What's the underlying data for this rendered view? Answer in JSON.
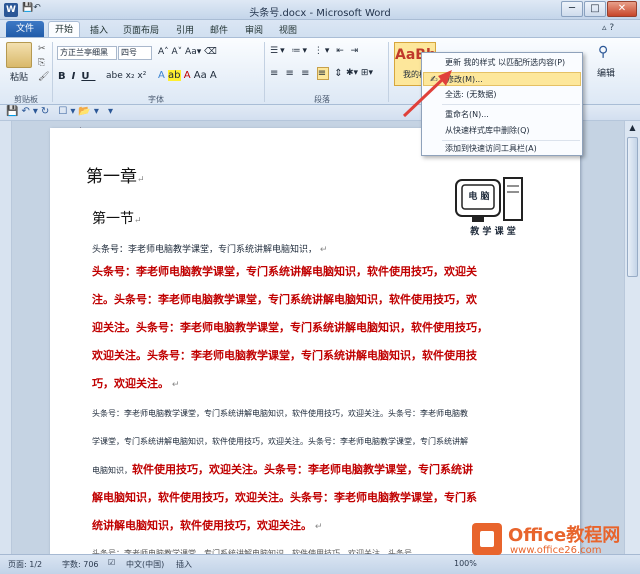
{
  "window": {
    "title": "头条号.docx - Microsoft Word",
    "app_icon": "W",
    "min": "─",
    "max": "□",
    "close": "✕"
  },
  "tabs": [
    "文件",
    "开始",
    "插入",
    "页面布局",
    "引用",
    "邮件",
    "审阅",
    "视图"
  ],
  "ribbon": {
    "paste": "粘贴",
    "clipboard_label": "剪贴板",
    "font_name": "方正兰亭细黑",
    "font_size": "四号",
    "font_label": "字体",
    "paragraph_label": "段落",
    "style_sample": "AaBb",
    "style_name": "我的样",
    "edit": "编辑"
  },
  "context_menu": {
    "items": [
      "更新 我的样式 以匹配所选内容(P)",
      "修改(M)...",
      "全选: (无数据)",
      "重命名(N)...",
      "从快速样式库中删除(Q)",
      "添加到快速访问工具栏(A)"
    ]
  },
  "document": {
    "chapter": "第一章",
    "section": "第一节",
    "logo_top": "电 脑",
    "logo_bottom": "教 学 课 堂",
    "p1": "头条号：李老师电脑教学课堂，专门系统讲解电脑知识，",
    "p2_lines": [
      "头条号：李老师电脑教学课堂，专门系统讲解电脑知识，软件使用技巧，欢迎关",
      "注。头条号：李老师电脑教学课堂，专门系统讲解电脑知识，软件使用技巧，欢",
      "迎关注。头条号：李老师电脑教学课堂，专门系统讲解电脑知识，软件使用技巧，",
      "欢迎关注。头条号：李老师电脑教学课堂，专门系统讲解电脑知识，软件使用技",
      "巧，欢迎关注。"
    ],
    "p3_lines": [
      "头条号：李老师电脑教学课堂，专门系统讲解电脑知识，软件使用技巧，欢迎关注。头条号：李老师电脑教",
      "学课堂，专门系统讲解电脑知识，软件使用技巧，欢迎关注。头条号：李老师电脑教学课堂，专门系统讲解"
    ],
    "p3_mixed_normal": "电脑知识，",
    "p3_mixed_red": "软件使用技巧，欢迎关注。头条号：李老师电脑教学课堂，专门系统讲",
    "p4_lines": [
      "解电脑知识，软件使用技巧，欢迎关注。头条号：李老师电脑教学课堂，专门系",
      "统讲解电脑知识，软件使用技巧，欢迎关注。"
    ],
    "p5_partial": "头条号：李老师电脑教学课堂，专门系统讲解电脑知识，软件使用技巧，欢迎关注。头条号"
  },
  "status": {
    "page": "页面: 1/2",
    "words": "字数: 706",
    "lang": "中文(中国)",
    "mode": "插入",
    "zoom": "100%"
  },
  "watermark": {
    "brand": "Office教程网",
    "url": "www.office26.com"
  },
  "colors": {
    "accent": "#2b5797",
    "red_text": "#c00000",
    "highlight": "#fde79b",
    "arrow": "#e0403a"
  }
}
